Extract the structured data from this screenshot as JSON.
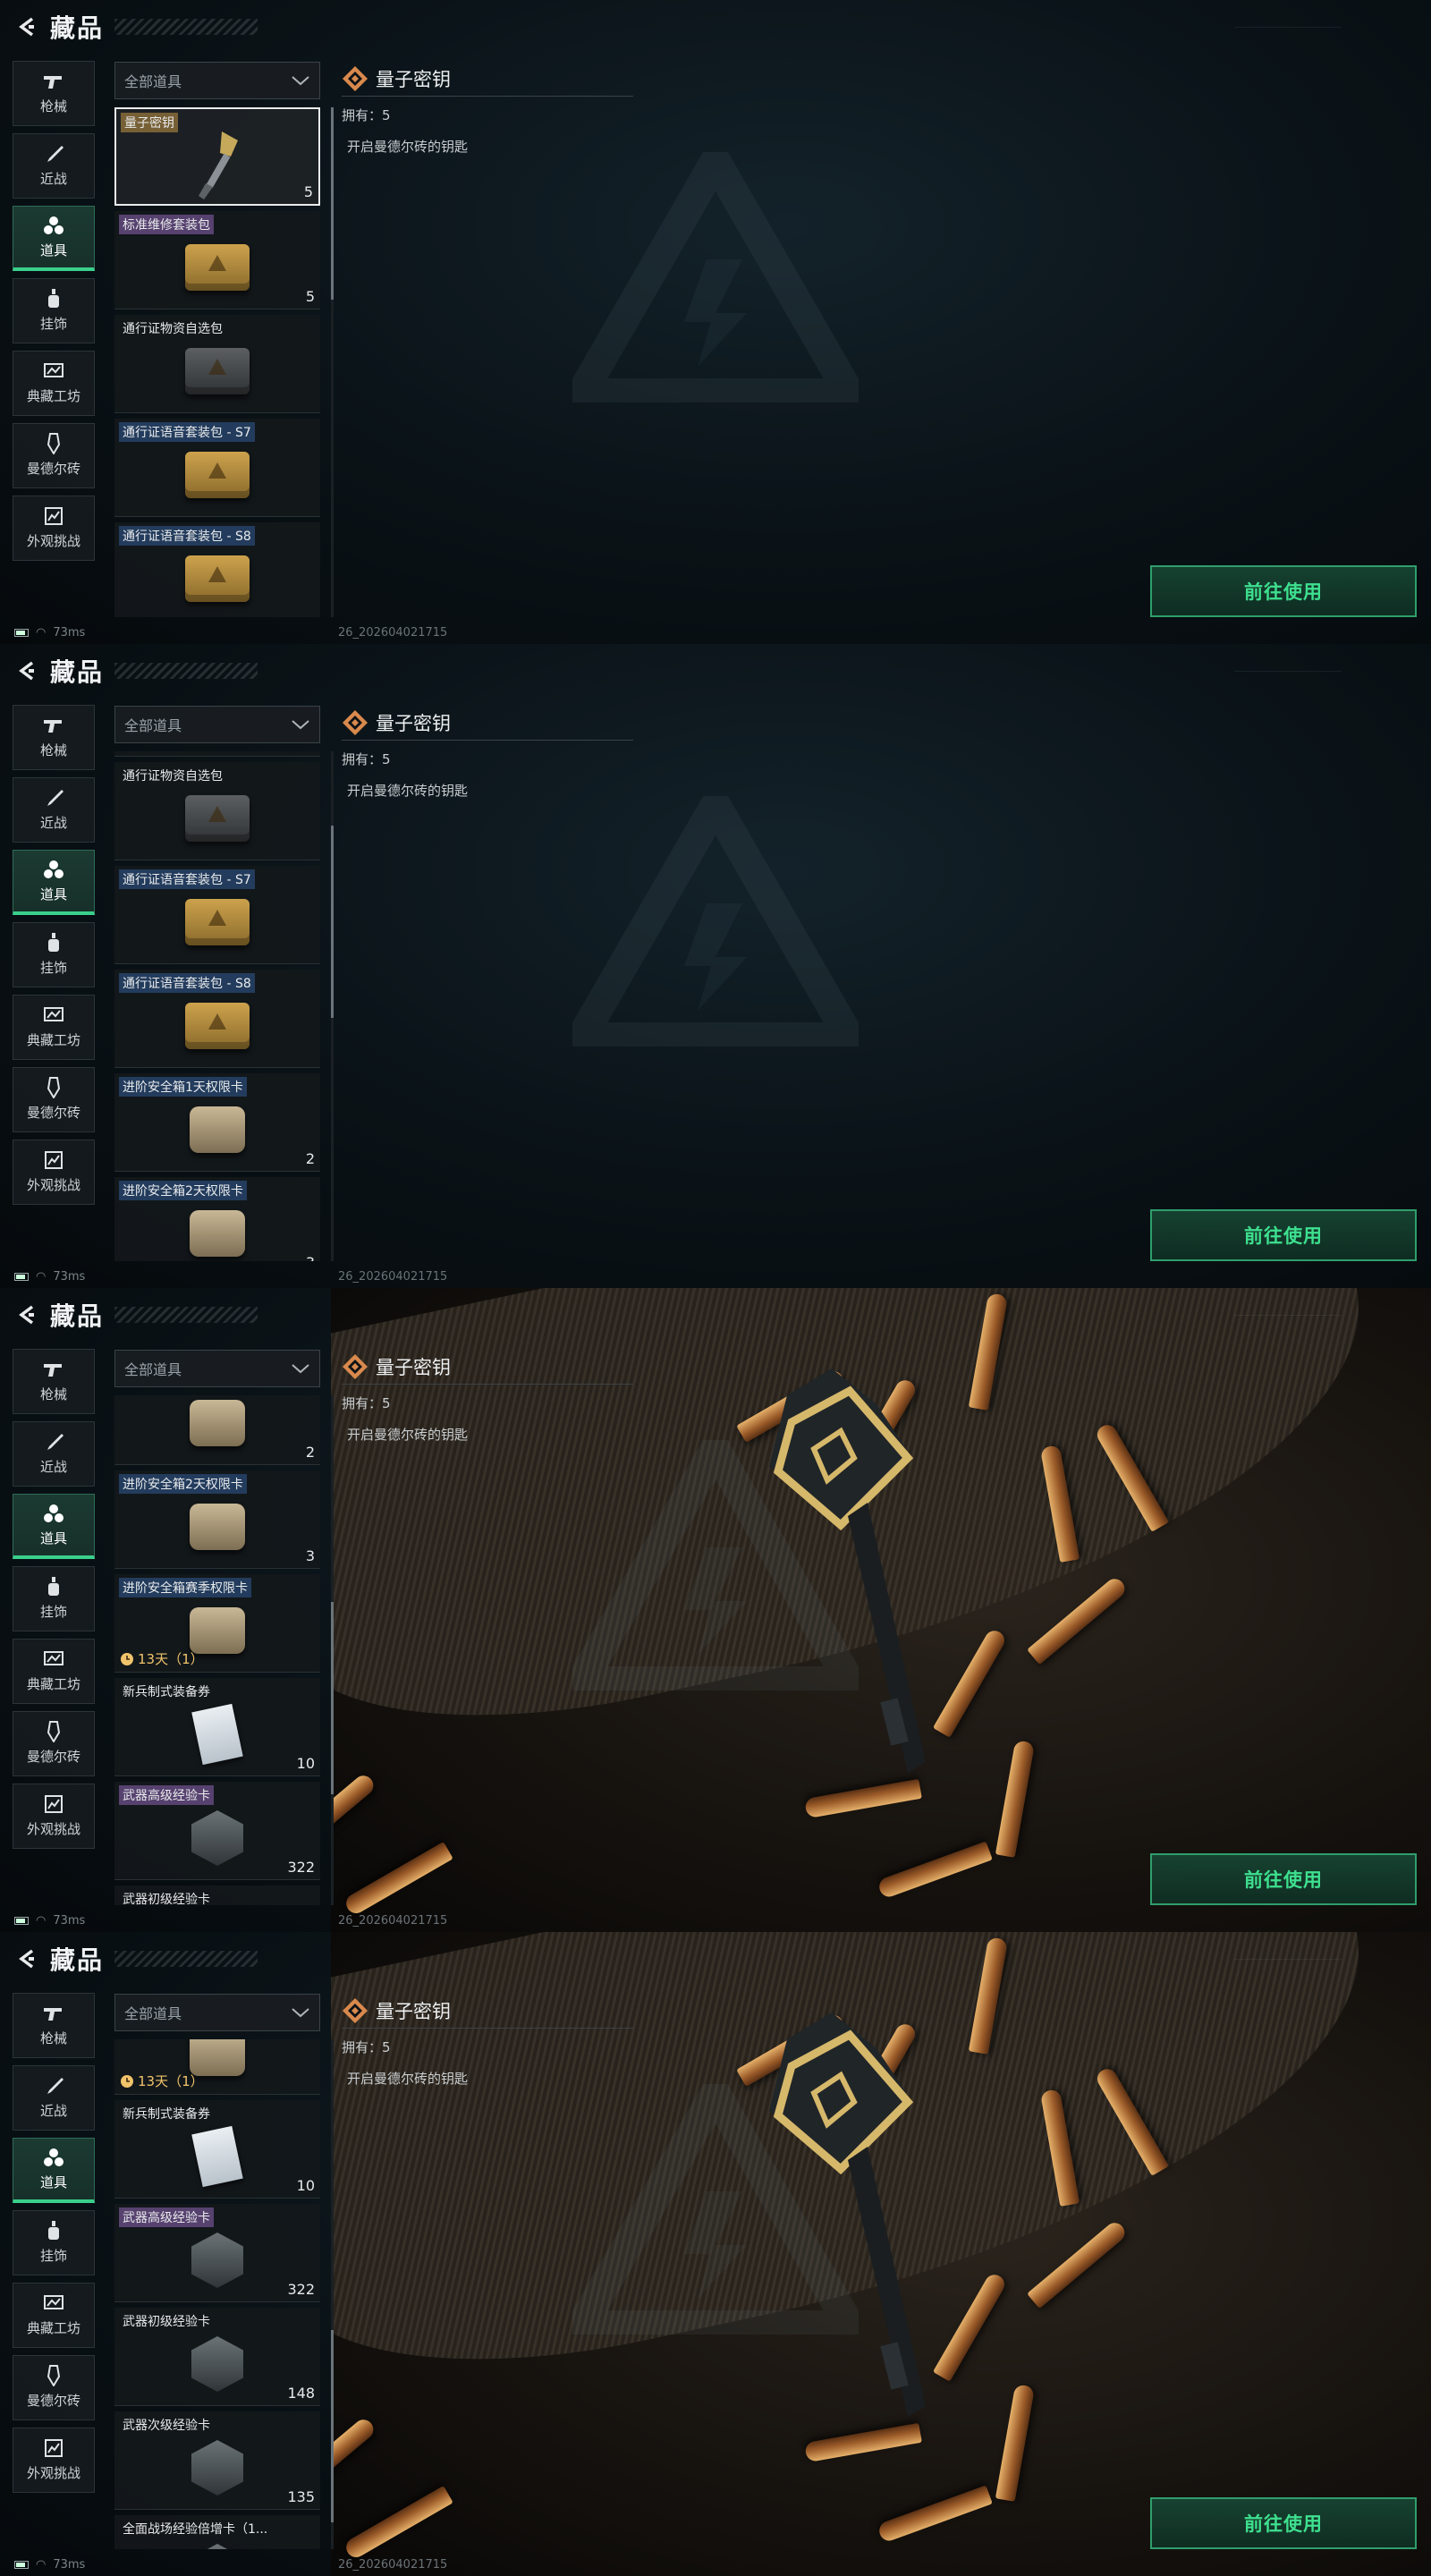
{
  "header": {
    "title": "藏品"
  },
  "nav": [
    {
      "label": "枪械",
      "icon": "gun-icon"
    },
    {
      "label": "近战",
      "icon": "knife-icon"
    },
    {
      "label": "道具",
      "icon": "props-icon",
      "active": true
    },
    {
      "label": "挂饰",
      "icon": "charm-icon"
    },
    {
      "label": "典藏工坊",
      "icon": "workshop-icon"
    },
    {
      "label": "曼德尔砖",
      "icon": "brick-icon"
    },
    {
      "label": "外观挑战",
      "icon": "challenge-icon"
    }
  ],
  "filter": {
    "label": "全部道具"
  },
  "items": [
    {
      "name": "量子密钥",
      "tag": "gold",
      "count": "5",
      "img": "key",
      "timer": ""
    },
    {
      "name": "标准维修套装包",
      "tag": "purple",
      "count": "5",
      "img": "box",
      "timer": ""
    },
    {
      "name": "通行证物资自选包",
      "tag": "none",
      "count": "",
      "img": "box-dark",
      "timer": ""
    },
    {
      "name": "通行证语音套装包 - S7",
      "tag": "blue",
      "count": "",
      "img": "box",
      "timer": ""
    },
    {
      "name": "通行证语音套装包 - S8",
      "tag": "blue",
      "count": "",
      "img": "box",
      "timer": ""
    },
    {
      "name": "进阶安全箱1天权限卡",
      "tag": "blue",
      "count": "2",
      "img": "case",
      "timer": ""
    },
    {
      "name": "进阶安全箱2天权限卡",
      "tag": "blue",
      "count": "3",
      "img": "case",
      "timer": ""
    },
    {
      "name": "进阶安全箱赛季权限卡",
      "tag": "blue",
      "count": "",
      "img": "case",
      "timer": "13天（1）"
    },
    {
      "name": "新兵制式装备券",
      "tag": "none",
      "count": "10",
      "img": "paper",
      "timer": ""
    },
    {
      "name": "武器高级经验卡",
      "tag": "purple",
      "count": "322",
      "img": "hex",
      "timer": ""
    },
    {
      "name": "武器初级经验卡",
      "tag": "none",
      "count": "148",
      "img": "hex",
      "timer": ""
    },
    {
      "name": "武器次级经验卡",
      "tag": "none",
      "count": "135",
      "img": "hex",
      "timer": ""
    },
    {
      "name": "全面战场经验倍增卡（1...",
      "tag": "none",
      "count": "",
      "img": "hex",
      "timer": ""
    }
  ],
  "detail": {
    "name": "量子密钥",
    "own": "拥有：5",
    "desc": "开启曼德尔砖的钥匙"
  },
  "action": {
    "label": "前往使用"
  },
  "status": {
    "ping": "73ms",
    "build": "26_202604021715"
  },
  "frames": [
    {
      "scroll": 0,
      "art": false
    },
    {
      "scroll": 220,
      "art": false
    },
    {
      "scroll": 612,
      "art": true
    },
    {
      "scroll": 860,
      "art": true
    }
  ],
  "colors": {
    "accent": "#3ad08c",
    "button_text": "#3ee08f",
    "timer": "#f1c36b"
  }
}
